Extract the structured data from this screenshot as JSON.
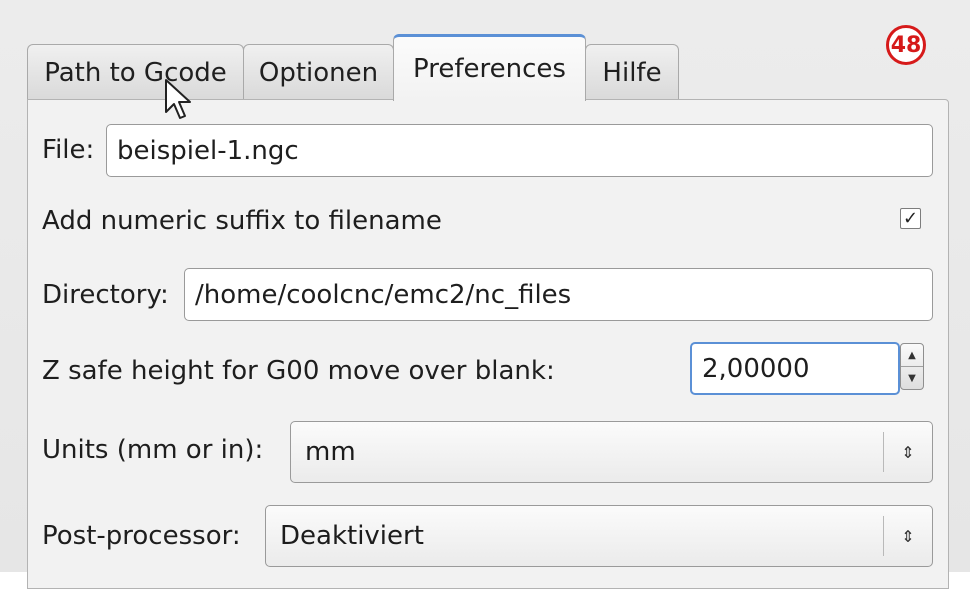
{
  "badge": "48",
  "tabs": [
    {
      "label": "Path to Gcode"
    },
    {
      "label": "Optionen"
    },
    {
      "label": "Preferences"
    },
    {
      "label": "Hilfe"
    }
  ],
  "file": {
    "label": "File:",
    "value": "beispiel-1.ngc"
  },
  "suffix": {
    "label": "Add numeric suffix to filename",
    "checked": true,
    "mark": "✓"
  },
  "directory": {
    "label": "Directory:",
    "value": "/home/coolcnc/emc2/nc_files"
  },
  "zsafe": {
    "label": "Z safe height for G00 move over blank:",
    "value": "2,00000"
  },
  "units": {
    "label": "Units (mm or in):",
    "value": "mm"
  },
  "postprocessor": {
    "label": "Post-processor:",
    "value": "Deaktiviert"
  },
  "colors": {
    "accent": "#5b90d6",
    "badge": "#d61a1a"
  }
}
